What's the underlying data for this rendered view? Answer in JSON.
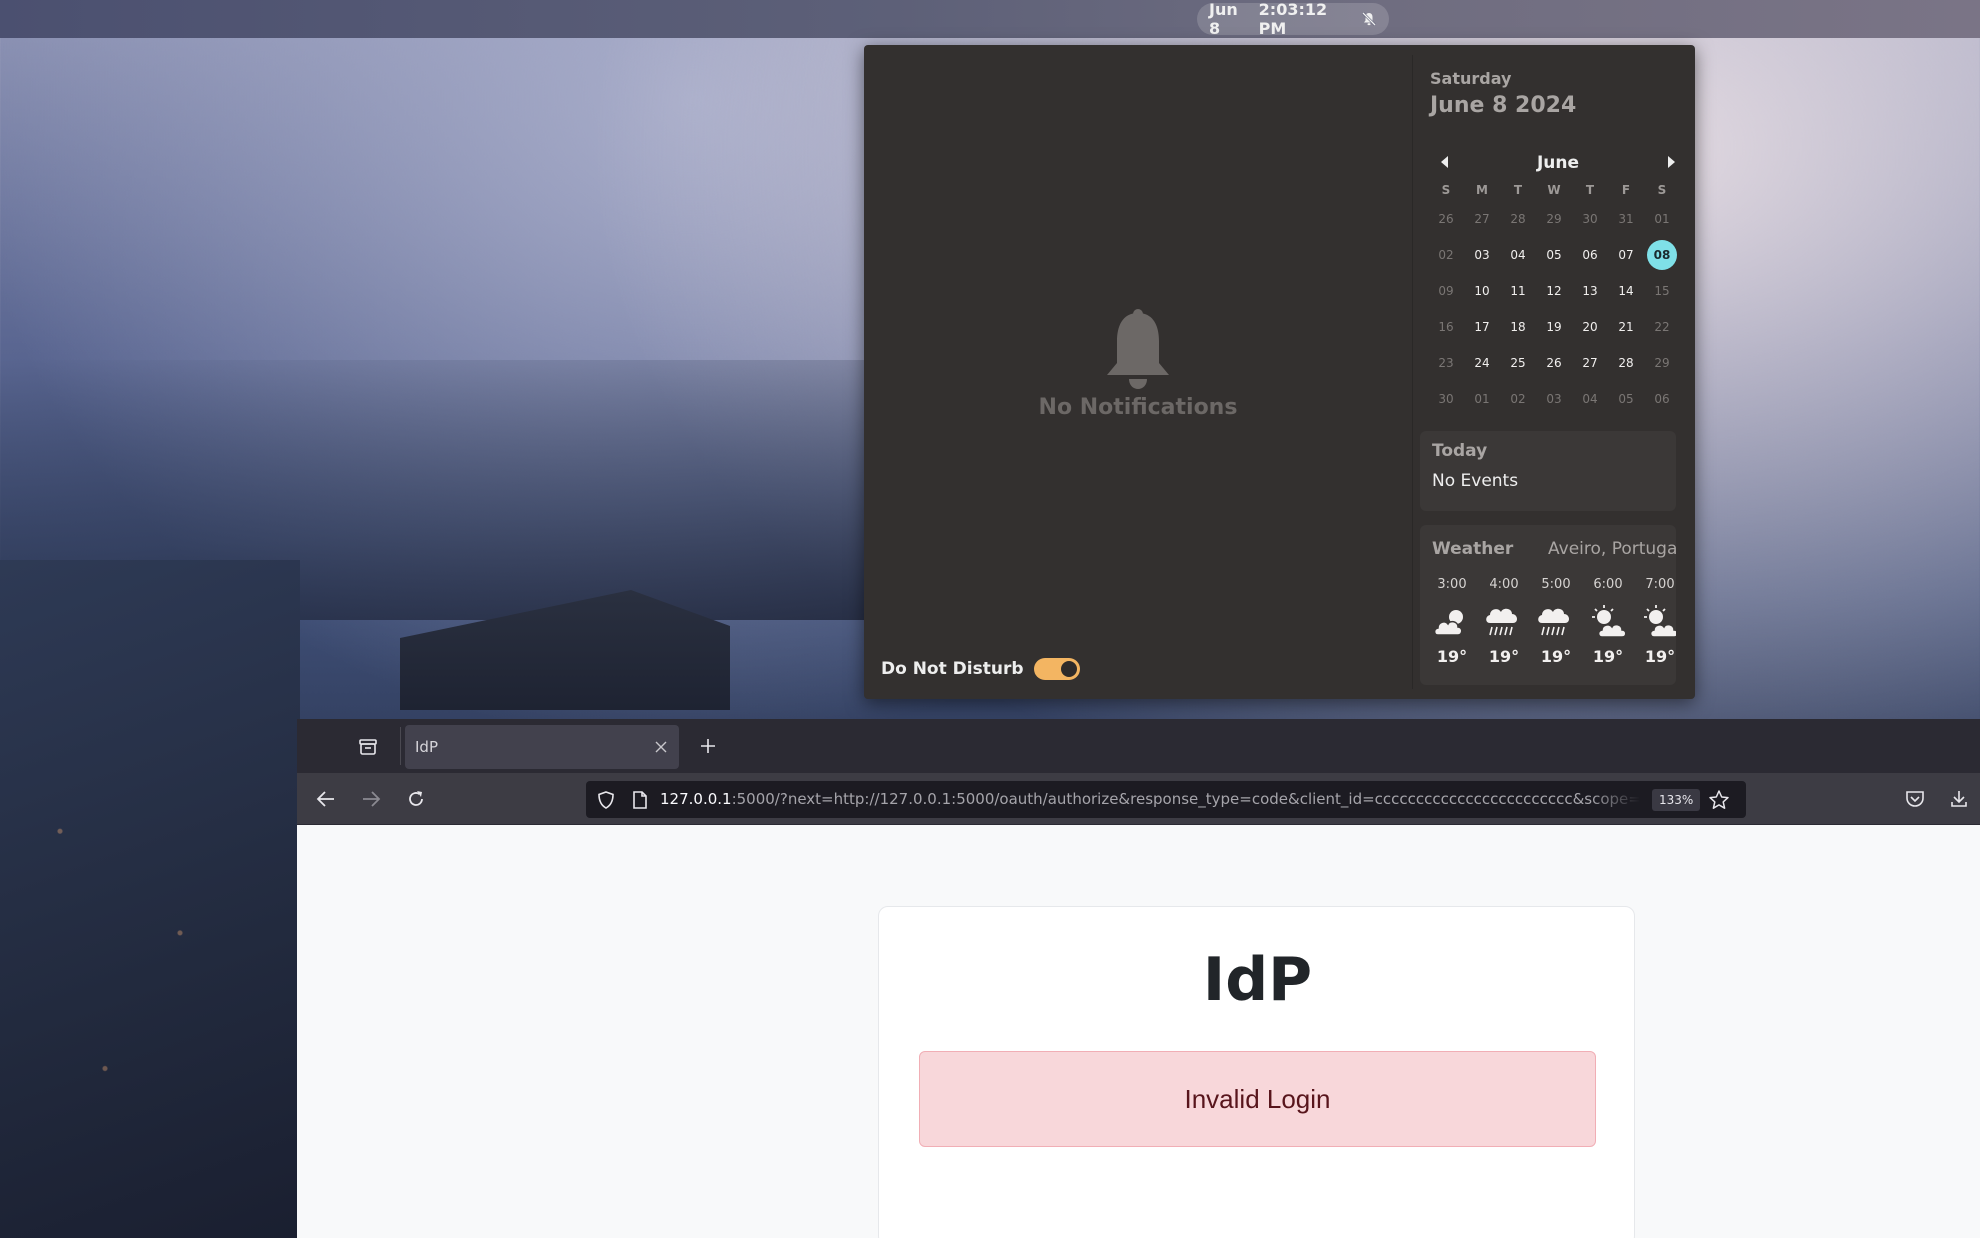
{
  "topbar": {
    "date": "Jun 8",
    "time": "2:03:12 PM",
    "notifications_icon": "bell-off-icon"
  },
  "notifications": {
    "empty_text": "No Notifications",
    "dnd_label": "Do Not Disturb",
    "dnd_enabled": true
  },
  "calendar": {
    "weekday": "Saturday",
    "full_date": "June 8 2024",
    "month": "June",
    "dow": [
      "S",
      "M",
      "T",
      "W",
      "T",
      "F",
      "S"
    ],
    "weeks": [
      [
        "26",
        "27",
        "28",
        "29",
        "30",
        "31",
        "01"
      ],
      [
        "02",
        "03",
        "04",
        "05",
        "06",
        "07",
        "08"
      ],
      [
        "09",
        "10",
        "11",
        "12",
        "13",
        "14",
        "15"
      ],
      [
        "16",
        "17",
        "18",
        "19",
        "20",
        "21",
        "22"
      ],
      [
        "23",
        "24",
        "25",
        "26",
        "27",
        "28",
        "29"
      ],
      [
        "30",
        "01",
        "02",
        "03",
        "04",
        "05",
        "06"
      ]
    ],
    "selected": "08"
  },
  "events": {
    "title": "Today",
    "empty_text": "No Events"
  },
  "weather": {
    "title": "Weather",
    "location": "Aveiro, Portuga",
    "forecast": [
      {
        "time": "3:00",
        "icon": "cloudy-sun-icon",
        "temp": "19°"
      },
      {
        "time": "4:00",
        "icon": "rain-icon",
        "temp": "19°"
      },
      {
        "time": "5:00",
        "icon": "rain-icon",
        "temp": "19°"
      },
      {
        "time": "6:00",
        "icon": "partly-cloudy-icon",
        "temp": "19°"
      },
      {
        "time": "7:00",
        "icon": "partly-cloudy-icon",
        "temp": "19°"
      }
    ]
  },
  "browser": {
    "tab_title": "IdP",
    "url_host": "127.0.0.1",
    "url_rest": ":5000/?next=http://127.0.0.1:5000/oauth/authorize&response_type=code&client_id=cccccccccccccccccccccccc&scope=",
    "zoom": "133%"
  },
  "page": {
    "title": "IdP",
    "alert": "Invalid Login"
  }
}
